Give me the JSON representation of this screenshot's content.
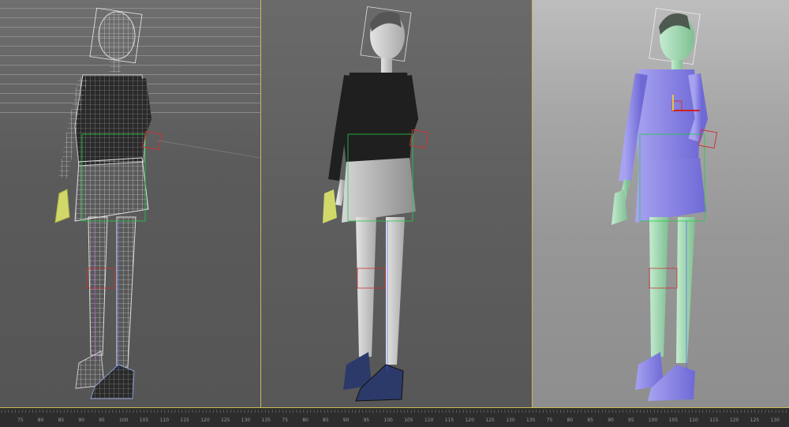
{
  "viewports": [
    {
      "id": "wireframe",
      "mode": "Wireframe",
      "accent": "#333333"
    },
    {
      "id": "shaded",
      "mode": "Shaded",
      "accent": "#1f1f1f"
    },
    {
      "id": "colored",
      "mode": "Colored",
      "accent": "#8b86e6"
    }
  ],
  "timeline": {
    "labels": [
      "75",
      "80",
      "85",
      "90",
      "95",
      "100",
      "105",
      "110",
      "115",
      "120",
      "125",
      "130",
      "135",
      "75",
      "80",
      "85",
      "90",
      "95",
      "100",
      "105",
      "110",
      "115",
      "120",
      "125",
      "130",
      "135",
      "75",
      "80",
      "85",
      "90",
      "95",
      "100",
      "105",
      "110",
      "115",
      "120",
      "125",
      "130"
    ]
  },
  "colors": {
    "viewport_border": "#c9b95a",
    "skin_gray": "#cfcfcf",
    "skin_green": "#a8dcb6",
    "cloth_purple": "#8b86e6",
    "cloth_dark": "#1f1f1f",
    "shoe_blue": "#2c3a6a",
    "bone_green": "#22cc44",
    "bone_red": "#cc3333"
  }
}
